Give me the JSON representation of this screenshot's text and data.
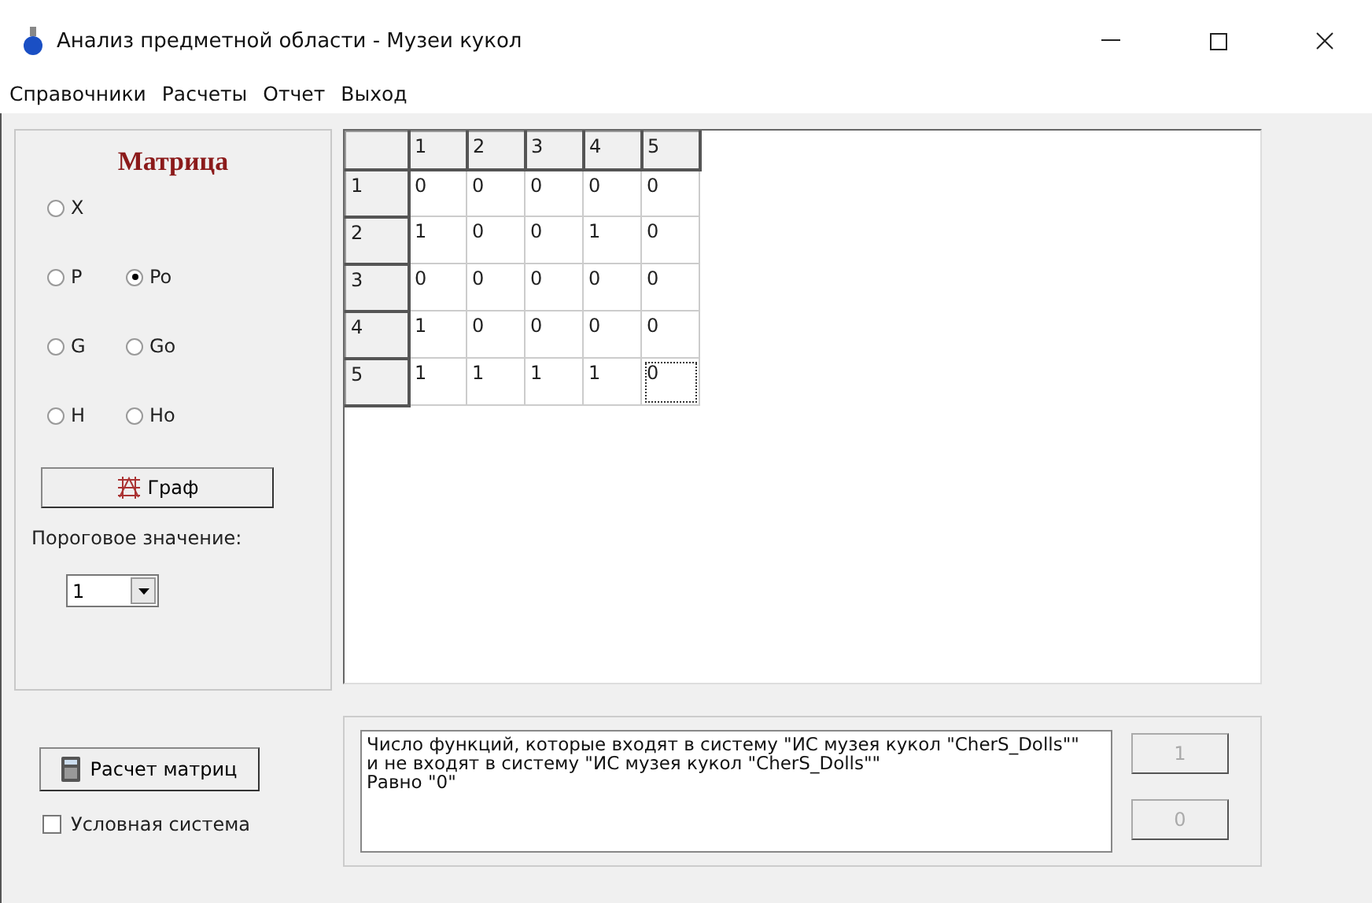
{
  "window": {
    "title": "Анализ предметной области - Музеи кукол"
  },
  "menu": [
    "Справочники",
    "Расчеты",
    "Отчет",
    "Выход"
  ],
  "left_panel": {
    "heading": "Матрица",
    "radios": [
      {
        "label": "X",
        "selected": false
      },
      {
        "label": "P",
        "selected": false
      },
      {
        "label": "Po",
        "selected": true
      },
      {
        "label": "G",
        "selected": false
      },
      {
        "label": "Go",
        "selected": false
      },
      {
        "label": "H",
        "selected": false
      },
      {
        "label": "Ho",
        "selected": false
      }
    ],
    "graph_button": "Граф",
    "threshold_label": "Пороговое значение:",
    "threshold_value": "1"
  },
  "matrix": {
    "columns": [
      "1",
      "2",
      "3",
      "4",
      "5"
    ],
    "rows": [
      {
        "header": "1",
        "cells": [
          {
            "value": "0",
            "focused": false
          },
          {
            "value": "0",
            "focused": false
          },
          {
            "value": "0",
            "focused": false
          },
          {
            "value": "0",
            "focused": false
          },
          {
            "value": "0",
            "focused": false
          }
        ]
      },
      {
        "header": "2",
        "cells": [
          {
            "value": "1",
            "focused": false
          },
          {
            "value": "0",
            "focused": false
          },
          {
            "value": "0",
            "focused": false
          },
          {
            "value": "1",
            "focused": false
          },
          {
            "value": "0",
            "focused": false
          }
        ]
      },
      {
        "header": "3",
        "cells": [
          {
            "value": "0",
            "focused": false
          },
          {
            "value": "0",
            "focused": false
          },
          {
            "value": "0",
            "focused": false
          },
          {
            "value": "0",
            "focused": false
          },
          {
            "value": "0",
            "focused": false
          }
        ]
      },
      {
        "header": "4",
        "cells": [
          {
            "value": "1",
            "focused": false
          },
          {
            "value": "0",
            "focused": false
          },
          {
            "value": "0",
            "focused": false
          },
          {
            "value": "0",
            "focused": false
          },
          {
            "value": "0",
            "focused": false
          }
        ]
      },
      {
        "header": "5",
        "cells": [
          {
            "value": "1",
            "focused": false
          },
          {
            "value": "1",
            "focused": false
          },
          {
            "value": "1",
            "focused": false
          },
          {
            "value": "1",
            "focused": false
          },
          {
            "value": "0",
            "focused": true
          }
        ]
      }
    ]
  },
  "calc_button": "Расчет матриц",
  "conditional_system": {
    "label": "Условная система",
    "checked": false
  },
  "result": {
    "lines": [
      "Число функций, которые входят в систему \"ИС музея кукол \"CherS_Dolls\"\"",
      "и не входят в систему \"ИС музея кукол \"CherS_Dolls\"\"",
      "Равно \"0\""
    ],
    "buttons": [
      {
        "label": "1",
        "disabled": true
      },
      {
        "label": "0",
        "disabled": true
      }
    ]
  }
}
